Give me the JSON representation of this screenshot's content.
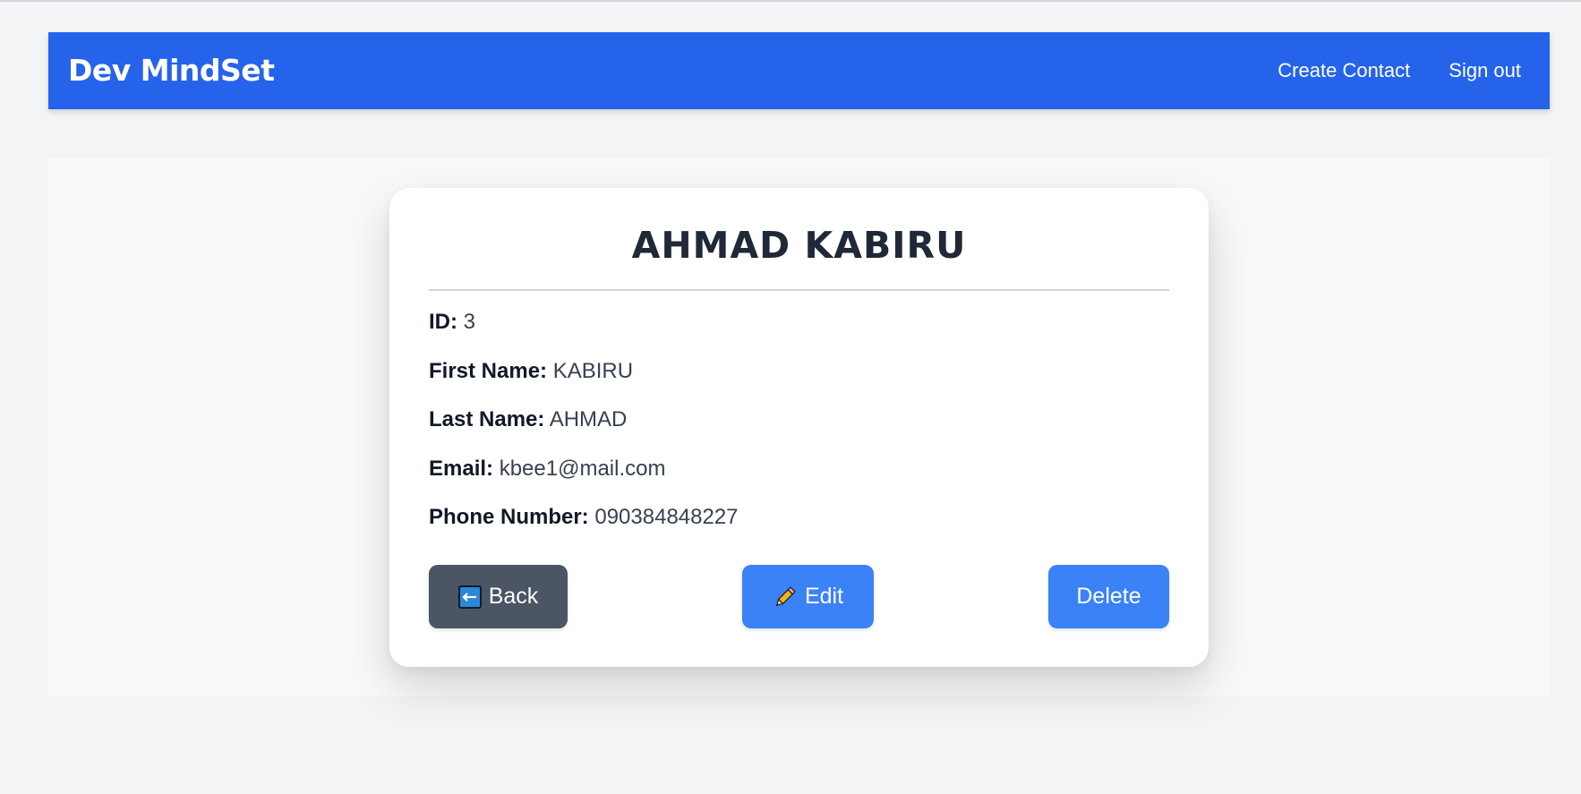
{
  "header": {
    "brand": "Dev MindSet",
    "nav": {
      "create_contact": "Create Contact",
      "sign_out": "Sign out"
    }
  },
  "contact": {
    "title": "AHMAD KABIRU",
    "fields": {
      "id": {
        "label": "ID:",
        "value": "3"
      },
      "first_name": {
        "label": "First Name:",
        "value": "KABIRU"
      },
      "last_name": {
        "label": "Last Name:",
        "value": "AHMAD"
      },
      "email": {
        "label": "Email:",
        "value": "kbee1@mail.com"
      },
      "phone": {
        "label": "Phone Number:",
        "value": "090384848227"
      }
    }
  },
  "actions": {
    "back": {
      "label": "Back",
      "icon": "back-arrow-icon"
    },
    "edit": {
      "label": "Edit",
      "icon": "pencil-icon"
    },
    "delete": {
      "label": "Delete"
    }
  },
  "colors": {
    "navbar": "#2563eb",
    "primary_button": "#3b82f6",
    "back_button": "#4b5563",
    "page_background": "#f3f4f6"
  }
}
